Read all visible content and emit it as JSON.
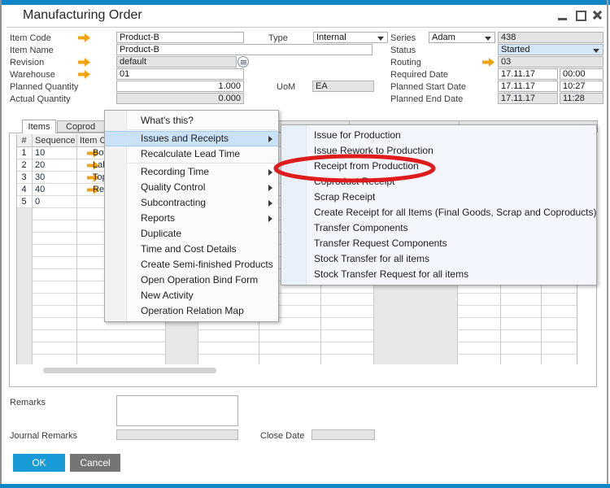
{
  "window": {
    "title": "Manufacturing Order"
  },
  "form": {
    "item_code": {
      "label": "Item Code",
      "value": "Product-B"
    },
    "item_name": {
      "label": "Item Name",
      "value": "Product-B"
    },
    "revision": {
      "label": "Revision",
      "value": "default"
    },
    "warehouse": {
      "label": "Warehouse",
      "value": "01"
    },
    "planned_quantity": {
      "label": "Planned Quantity",
      "value": "1.000"
    },
    "actual_quantity": {
      "label": "Actual Quantity",
      "value": "0.000"
    },
    "type": {
      "label": "Type",
      "value": "Internal"
    },
    "uom": {
      "label": "UoM",
      "value": "EA"
    },
    "series": {
      "label": "Series",
      "value": "Adam",
      "number": "438"
    },
    "status": {
      "label": "Status",
      "value": "Started"
    },
    "routing": {
      "label": "Routing",
      "value": "03"
    },
    "required_date": {
      "label": "Required Date",
      "date": "17.11.17",
      "time": "00:00"
    },
    "planned_start_date": {
      "label": "Planned Start Date",
      "date": "17.11.17",
      "time": "10:27"
    },
    "planned_end_date": {
      "label": "Planned End Date",
      "date": "17.11.17",
      "time": "11:28"
    }
  },
  "tabs": {
    "items": {
      "label": "Items"
    },
    "coproducts": {
      "label": "Coprod"
    }
  },
  "table": {
    "headers": {
      "num": "#",
      "sequence": "Sequence",
      "item_code": "Item Code"
    },
    "rows": [
      {
        "num": "1",
        "sequence": "10",
        "item": "Bot"
      },
      {
        "num": "2",
        "sequence": "20",
        "item": "Lab"
      },
      {
        "num": "3",
        "sequence": "30",
        "item": "Top"
      },
      {
        "num": "4",
        "sequence": "40",
        "item": "Rec"
      },
      {
        "num": "5",
        "sequence": "0",
        "item": ""
      }
    ]
  },
  "context_menu": {
    "items": [
      {
        "label": "What's this?"
      },
      {
        "label": "Issues and Receipts"
      },
      {
        "label": "Recalculate Lead Time"
      },
      {
        "label": "Recording Time"
      },
      {
        "label": "Quality Control"
      },
      {
        "label": "Subcontracting"
      },
      {
        "label": "Reports"
      },
      {
        "label": "Duplicate"
      },
      {
        "label": "Time and Cost Details"
      },
      {
        "label": "Create Semi-finished Products"
      },
      {
        "label": "Open Operation Bind Form"
      },
      {
        "label": "New Activity"
      },
      {
        "label": "Operation Relation Map"
      }
    ]
  },
  "submenu": {
    "items": [
      {
        "label": "Issue for Production"
      },
      {
        "label": "Issue Rework to Production"
      },
      {
        "label": "Receipt from Production"
      },
      {
        "label": "Coproduct Receipt"
      },
      {
        "label": "Scrap Receipt"
      },
      {
        "label": "Create Receipt for all Items (Final Goods, Scrap and Coproducts)"
      },
      {
        "label": "Transfer Components"
      },
      {
        "label": "Transfer Request Components"
      },
      {
        "label": "Stock Transfer for all items"
      },
      {
        "label": "Stock Transfer Request for all items"
      }
    ]
  },
  "annotation": {
    "circled_item": "Receipt from Production",
    "color": "#DE1C1C"
  },
  "footer": {
    "remarks": {
      "label": "Remarks",
      "value": ""
    },
    "journal_remarks": {
      "label": "Journal Remarks",
      "value": ""
    },
    "close_date": {
      "label": "Close Date",
      "value": ""
    },
    "ok_label": "OK",
    "cancel_label": "Cancel"
  },
  "colors": {
    "accent_blue": "#1287C8",
    "ok_button": "#189BD7",
    "cancel_button": "#757575",
    "menu_highlight": "#C9E2F7",
    "link_arrow_orange": "#F0A30A",
    "status_field_bg": "#D6E8F7",
    "annotation_red": "#DE1C1C"
  }
}
